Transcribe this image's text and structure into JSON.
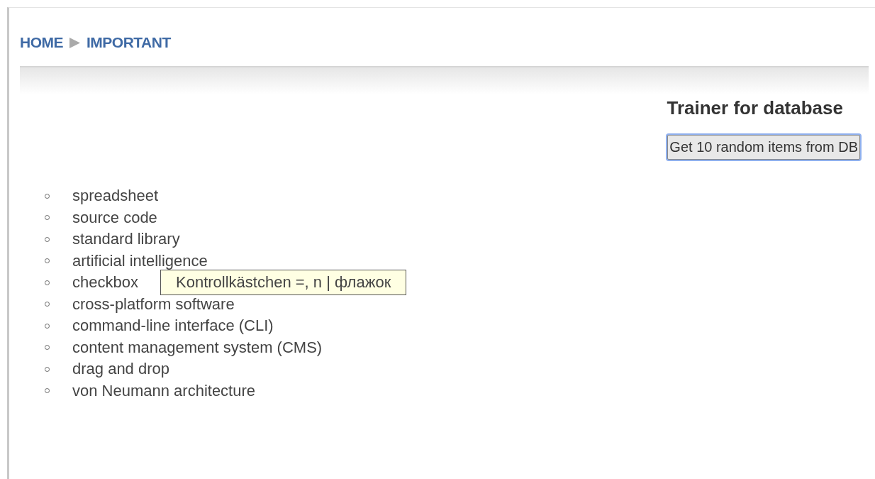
{
  "breadcrumb": [
    {
      "label": "HOME"
    },
    {
      "label": "IMPORTANT"
    }
  ],
  "title": "Trainer for database",
  "button": {
    "label": "Get 10 random items from DB",
    "focused": true
  },
  "items": [
    {
      "text": "spreadsheet"
    },
    {
      "text": "source code"
    },
    {
      "text": "standard library"
    },
    {
      "text": "artificial intelligence"
    },
    {
      "text": "checkbox",
      "tooltip": "Kontrollkästchen =, n | флажок"
    },
    {
      "text": "cross-platform software"
    },
    {
      "text": "command-line interface (CLI)"
    },
    {
      "text": "content management system (CMS)"
    },
    {
      "text": "drag and drop"
    },
    {
      "text": "von Neumann architecture"
    }
  ]
}
